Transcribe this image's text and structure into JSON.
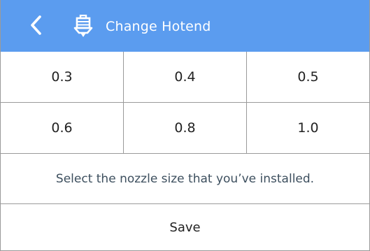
{
  "header": {
    "title": "Change Hotend",
    "back_icon": "chevron-left-icon",
    "title_icon": "hotend-icon",
    "background_color": "#5b9cef"
  },
  "nozzle_sizes": {
    "row1": [
      "0.3",
      "0.4",
      "0.5"
    ],
    "row2": [
      "0.6",
      "0.8",
      "1.0"
    ]
  },
  "message": "Select the nozzle size that you’ve installed.",
  "save_label": "Save"
}
